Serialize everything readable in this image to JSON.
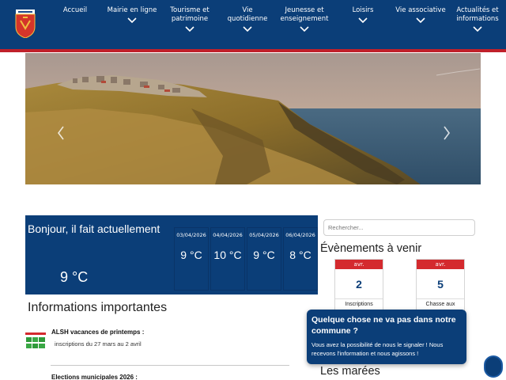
{
  "nav": {
    "items": [
      {
        "label": "Accueil",
        "chevron": false
      },
      {
        "label": "Mairie en ligne",
        "chevron": true
      },
      {
        "label": "Tourisme et patrimoine",
        "chevron": true
      },
      {
        "label": "Vie quotidienne",
        "chevron": true
      },
      {
        "label": "Jeunesse et enseignement",
        "chevron": true
      },
      {
        "label": "Loisirs",
        "chevron": true
      },
      {
        "label": "Vie associative",
        "chevron": true
      },
      {
        "label": "Actualités et informations",
        "chevron": true
      }
    ]
  },
  "colors": {
    "brand_blue": "#0b3e78",
    "accent_red": "#c0202a",
    "event_red": "#d42a2e"
  },
  "weather": {
    "greeting": "Bonjour, il fait actuellement",
    "current": "9 °C",
    "forecast": [
      {
        "date": "03/04/2026",
        "temp": "9 °C"
      },
      {
        "date": "04/04/2026",
        "temp": "10 °C"
      },
      {
        "date": "05/04/2026",
        "temp": "9 °C"
      },
      {
        "date": "06/04/2026",
        "temp": "8 °C"
      }
    ]
  },
  "info": {
    "title": "Informations importantes",
    "items": [
      {
        "title": "ALSH vacances de printemps :",
        "subtitle": "inscriptions du 27 mars au 2 avril"
      },
      {
        "title": "Elections municipales 2026 :"
      }
    ]
  },
  "search": {
    "placeholder": "Rechercher..."
  },
  "events": {
    "title": "Évènements à venir",
    "items": [
      {
        "month": "avr.",
        "day": "2",
        "label": "Inscriptions"
      },
      {
        "month": "avr.",
        "day": "5",
        "label": "Chasse aux"
      }
    ]
  },
  "popup": {
    "title": "Quelque chose ne va pas dans notre commune ?",
    "body": "Vous avez la possibilité de nous le signaler ! Nous recevons l'information et nous agissons !"
  },
  "tides": {
    "title": "Les marées"
  },
  "icons": {
    "logo": "coat-of-arms-icon",
    "prev": "chevron-left-icon",
    "next": "chevron-right-icon",
    "menu_chevron": "chevron-down-icon",
    "fab": "chat-bubble-icon"
  }
}
